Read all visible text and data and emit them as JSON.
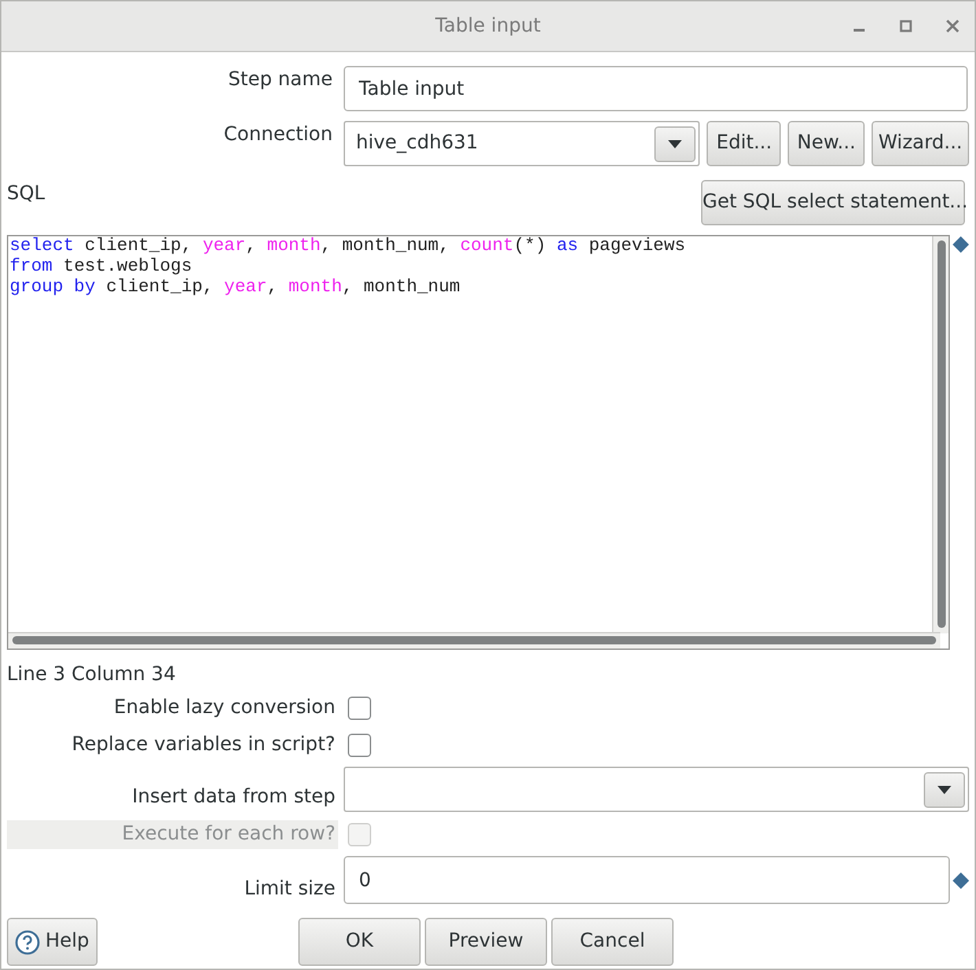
{
  "window": {
    "title": "Table input"
  },
  "step_name": {
    "label": "Step name",
    "value": "Table input"
  },
  "connection": {
    "label": "Connection",
    "value": "hive_cdh631",
    "buttons": [
      "Edit...",
      "New...",
      "Wizard..."
    ]
  },
  "sql": {
    "label": "SQL",
    "get_button": "Get SQL select statement...",
    "lines": [
      [
        {
          "kind": "keyword",
          "text": "select"
        },
        {
          "kind": "plain",
          "text": " client_ip, "
        },
        {
          "kind": "function",
          "text": "year"
        },
        {
          "kind": "plain",
          "text": ", "
        },
        {
          "kind": "function",
          "text": "month"
        },
        {
          "kind": "plain",
          "text": ", month_num, "
        },
        {
          "kind": "function",
          "text": "count"
        },
        {
          "kind": "plain",
          "text": "(*) "
        },
        {
          "kind": "keyword",
          "text": "as"
        },
        {
          "kind": "plain",
          "text": " pageviews"
        }
      ],
      [
        {
          "kind": "keyword",
          "text": "from"
        },
        {
          "kind": "plain",
          "text": " test.weblogs"
        }
      ],
      [
        {
          "kind": "keyword",
          "text": "group by"
        },
        {
          "kind": "plain",
          "text": " client_ip, "
        },
        {
          "kind": "function",
          "text": "year"
        },
        {
          "kind": "plain",
          "text": ", "
        },
        {
          "kind": "function",
          "text": "month"
        },
        {
          "kind": "plain",
          "text": ", month_num"
        }
      ]
    ],
    "position": "Line 3 Column 34"
  },
  "options": [
    {
      "kind": "checkbox",
      "label": "Enable lazy conversion",
      "checked": false,
      "disabled": false
    },
    {
      "kind": "checkbox",
      "label": "Replace variables in script?",
      "checked": false,
      "disabled": false
    },
    {
      "kind": "dropdown",
      "label": "Insert data from step",
      "disabled": false
    },
    {
      "kind": "checkbox",
      "label": "Execute for each row?",
      "checked": false,
      "disabled": true
    },
    {
      "kind": "text",
      "label": "Limit size",
      "value": "0",
      "disabled": false
    }
  ],
  "help_button": "Help",
  "buttons": [
    "OK",
    "Preview",
    "Cancel"
  ]
}
